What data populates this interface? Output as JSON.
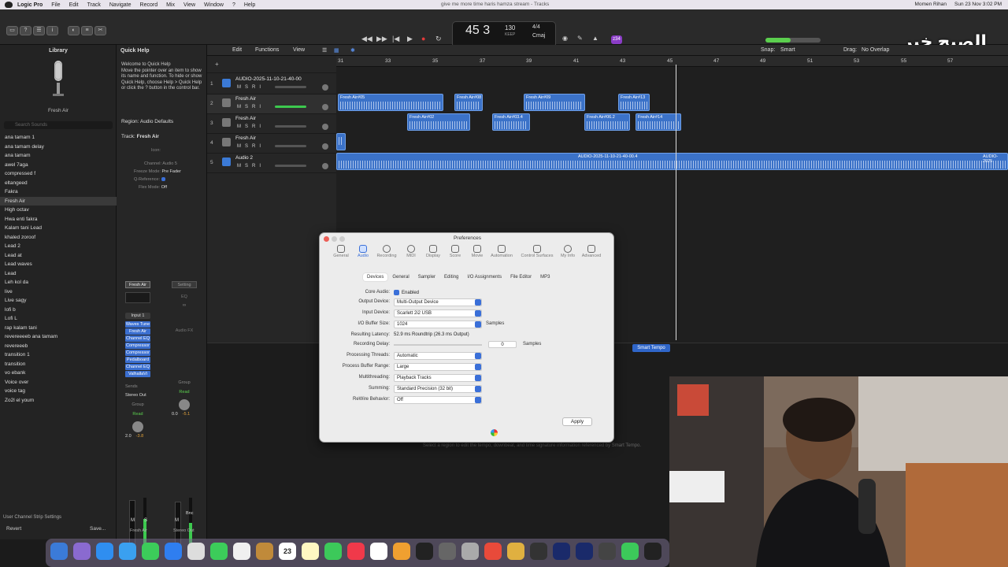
{
  "menubar": {
    "app": "Logic Pro",
    "items": [
      "File",
      "Edit",
      "Track",
      "Navigate",
      "Record",
      "Mix",
      "View",
      "Window",
      "?",
      "Help"
    ],
    "window_title": "give me more time haris hamza stream - Tracks",
    "user": "Momen Rihan",
    "clock": "Sun 23 Nov 3:02 PM"
  },
  "control": {
    "bar": "45",
    "beat": "3",
    "bpm": "130",
    "bpm_label": "KEEP",
    "time_sig": "4/4",
    "key": "Cmaj",
    "cpu_badge": "z34",
    "master_volume_fraction": 0.45
  },
  "watermark": "الصبح خير",
  "library": {
    "title": "Library",
    "preset_name": "Fresh Air",
    "search_placeholder": "Search Sounds",
    "items": [
      "ana tamam 1",
      "ana tamam delay",
      "ana tamam",
      "awel 7aga",
      "compressed f",
      "eltangeed",
      "Fakra",
      "Fresh Air",
      "High octav",
      "Hwa enti fakra",
      "Kalam tani Lead",
      "khaled zoroof",
      "Lead 2",
      "Lead at",
      "Lead waves",
      "Lead",
      "Leh kol da",
      "live",
      "Live sagy",
      "lofi b",
      "Lofi L",
      "rap kalam tani",
      "revereeeeb ana tamam",
      "revereeeb",
      "transition 1",
      "transition",
      "vo ebank",
      "Voice over",
      "voice tag",
      "Zo2l el youm"
    ],
    "selected": "Fresh Air",
    "user_settings": "User Channel Strip Settings",
    "revert": "Revert",
    "save": "Save..."
  },
  "inspector": {
    "quick_help_title": "Quick Help",
    "quick_help_heading": "Welcome to Quick Help",
    "quick_help_body": "Move the pointer over an item to show its name and function. To hide or show Quick Help, choose Help > Quick Help or click the ? button in the control bar.",
    "region_label": "Region:",
    "region_value": "Audio Defaults",
    "track_label": "Track:",
    "track_value": "Fresh Air",
    "icon_label": "Icon:",
    "channel_label": "Channel:",
    "channel_value": "Audio 5",
    "freeze_label": "Freeze Mode:",
    "freeze_value": "Pre Fader",
    "qref_label": "Q-Reference:",
    "flex_label": "Flex Mode:",
    "flex_value": "Off",
    "strip1_name": "Fresh Air",
    "strip2_setting": "Setting",
    "eq": "EQ",
    "input": "Input 1",
    "plugins": [
      "Waves Tune",
      "Fresh Air",
      "Channel EQ",
      "Compressor",
      "Compressor",
      "Pedalboard",
      "Channel EQ",
      "ValhallaVi"
    ],
    "audio_fx": "Audio FX",
    "sends": "Sends",
    "stereo_out": "Stereo Out",
    "group": "Group",
    "read": "Read",
    "strip1_vol": "2.0",
    "strip1_peak": "-3.8",
    "strip2_vol": "0.0",
    "strip2_peak": "-5.1",
    "bnc": "Bnc",
    "strip1_label": "Fresh Air",
    "strip2_label": "Stereo Out"
  },
  "tracks_header": {
    "edit": "Edit",
    "functions": "Functions",
    "view": "View",
    "snap_label": "Snap:",
    "snap_value": "Smart",
    "drag_label": "Drag:",
    "drag_value": "No Overlap"
  },
  "tracks": [
    {
      "num": "1",
      "name": "AUDIO-2025-11-10-21-40-00"
    },
    {
      "num": "2",
      "name": "Fresh Air"
    },
    {
      "num": "3",
      "name": "Fresh Air"
    },
    {
      "num": "4",
      "name": "Fresh Air"
    },
    {
      "num": "5",
      "name": "Audio 2"
    }
  ],
  "ruler": [
    "31",
    "33",
    "35",
    "37",
    "39",
    "41",
    "43",
    "45",
    "47",
    "49",
    "51",
    "53",
    "55",
    "57"
  ],
  "regions": [
    "Fresh Air#05",
    "Fresh Air#08",
    "Fresh Air#09",
    "Fresh Air#13",
    "Fresh Air#02",
    "Fresh Air#03.4",
    "Fresh Air#06.2",
    "Fresh Air#14",
    "AUDIO-2025-11-10-21-40-00.4",
    "AUDIO-2025"
  ],
  "lower": {
    "smart_tempo": "Smart Tempo",
    "hint": "Select a region to edit the tempo, downbeat, and time signature information referenced by Smart Tempo."
  },
  "prefs": {
    "title": "Preferences",
    "tabs": [
      "General",
      "Audio",
      "Recording",
      "MIDI",
      "Display",
      "Score",
      "Movie",
      "Automation",
      "Control Surfaces",
      "My Info",
      "Advanced"
    ],
    "active_tab": "Audio",
    "subtabs": [
      "Devices",
      "General",
      "Sampler",
      "Editing",
      "I/O Assignments",
      "File Editor",
      "MP3"
    ],
    "core_audio_label": "Core Audio:",
    "core_audio_value": "Enabled",
    "output_label": "Output Device:",
    "output_value": "Multi-Output Device",
    "input_label": "Input Device:",
    "input_value": "Scarlett 2i2 USB",
    "buffer_label": "I/O Buffer Size:",
    "buffer_value": "1024",
    "samples": "Samples",
    "latency_label": "Resulting Latency:",
    "latency_value": "52.9 ms Roundtrip (26.3 ms Output)",
    "rec_delay_label": "Recording Delay:",
    "rec_delay_value": "0",
    "threads_label": "Processing Threads:",
    "threads_value": "Automatic",
    "range_label": "Process Buffer Range:",
    "range_value": "Large",
    "multithread_label": "Multithreading:",
    "multithread_value": "Playback Tracks",
    "summing_label": "Summing:",
    "summing_value": "Standard Precision (32 bit)",
    "rewire_label": "ReWire Behavior:",
    "rewire_value": "Off",
    "apply": "Apply"
  },
  "dock": {
    "calendar_day": "23"
  }
}
